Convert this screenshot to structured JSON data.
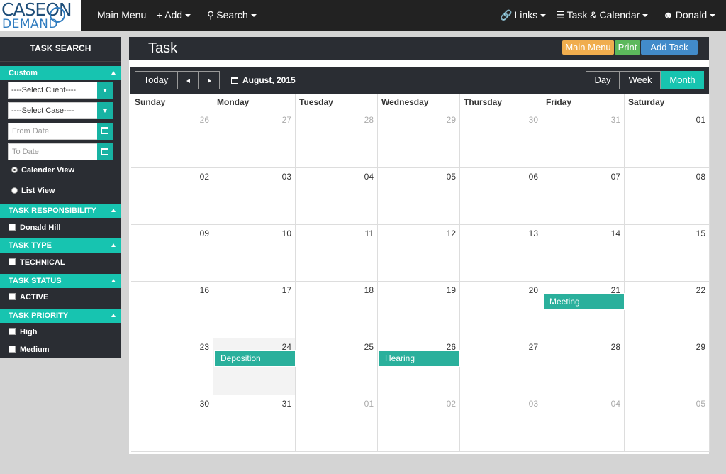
{
  "brand": {
    "line1": "CASEON",
    "line2": "DEMAND"
  },
  "topnav": {
    "main_menu": "Main Menu",
    "add": "Add",
    "search": "Search",
    "links": "Links",
    "task_calendar": "Task & Calendar",
    "user": "Donald"
  },
  "sidebar": {
    "title": "TASK SEARCH",
    "custom": {
      "label": "Custom",
      "client_select": "----Select Client----",
      "case_select": "----Select Case----",
      "from_date_placeholder": "From Date",
      "to_date_placeholder": "To Date",
      "calendar_view": "Calender View",
      "list_view": "List View"
    },
    "responsibility": {
      "label": "TASK RESPONSIBILITY",
      "items": [
        "Donald Hill"
      ]
    },
    "type": {
      "label": "TASK TYPE",
      "items": [
        "TECHNICAL"
      ]
    },
    "status": {
      "label": "TASK STATUS",
      "items": [
        "ACTIVE"
      ]
    },
    "priority": {
      "label": "TASK PRIORITY",
      "items": [
        "High",
        "Medium"
      ]
    }
  },
  "main": {
    "title": "Task",
    "main_menu_btn": "Main Menu",
    "print_btn": "Print",
    "add_task_btn": "Add Task"
  },
  "calendar": {
    "today_btn": "Today",
    "month_label": "August, 2015",
    "views": {
      "day": "Day",
      "week": "Week",
      "month": "Month"
    },
    "active_view": "Month",
    "weekdays": [
      "Sunday",
      "Monday",
      "Tuesday",
      "Wednesday",
      "Thursday",
      "Friday",
      "Saturday"
    ],
    "weeks": [
      [
        "26",
        "27",
        "28",
        "29",
        "30",
        "31",
        "01"
      ],
      [
        "02",
        "03",
        "04",
        "05",
        "06",
        "07",
        "08"
      ],
      [
        "09",
        "10",
        "11",
        "12",
        "13",
        "14",
        "15"
      ],
      [
        "16",
        "17",
        "18",
        "19",
        "20",
        "21",
        "22"
      ],
      [
        "23",
        "24",
        "25",
        "26",
        "27",
        "28",
        "29"
      ],
      [
        "30",
        "31",
        "01",
        "02",
        "03",
        "04",
        "05"
      ]
    ],
    "events": [
      {
        "title": "Meeting",
        "date": "21"
      },
      {
        "title": "Deposition",
        "date": "24"
      },
      {
        "title": "Hearing",
        "date": "26"
      }
    ]
  },
  "colors": {
    "accent": "#17c4b0",
    "event": "#2ab09c",
    "main_menu_btn": "#f0ad4e",
    "print_btn": "#5cb85c",
    "add_task_btn": "#428bca",
    "dark": "#222222"
  }
}
